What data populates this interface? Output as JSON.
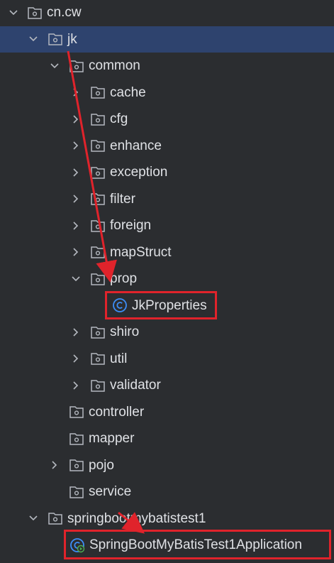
{
  "tree": {
    "root": "cn.cw",
    "jk": "jk",
    "common": "common",
    "children_common": [
      "cache",
      "cfg",
      "enhance",
      "exception",
      "filter",
      "foreign",
      "mapStruct"
    ],
    "prop": "prop",
    "jk_properties": "JkProperties",
    "children_common_after": [
      "shiro",
      "util",
      "validator"
    ],
    "controller": "controller",
    "mapper": "mapper",
    "pojo": "pojo",
    "service": "service",
    "springbootmybatistest1": "springbootmybatistest1",
    "app_class": "SpringBootMyBatisTest1Application"
  },
  "colors": {
    "background": "#2b2d30",
    "selected_row": "#2e436e",
    "text": "#dfe1e5",
    "annotation_red": "#e0232b",
    "class_icon": "#3d8ef7",
    "run_icon": "#4caf50"
  },
  "icons": [
    "folder-package-icon",
    "class-icon",
    "spring-boot-app-icon",
    "chevron-down-icon",
    "chevron-right-icon"
  ]
}
